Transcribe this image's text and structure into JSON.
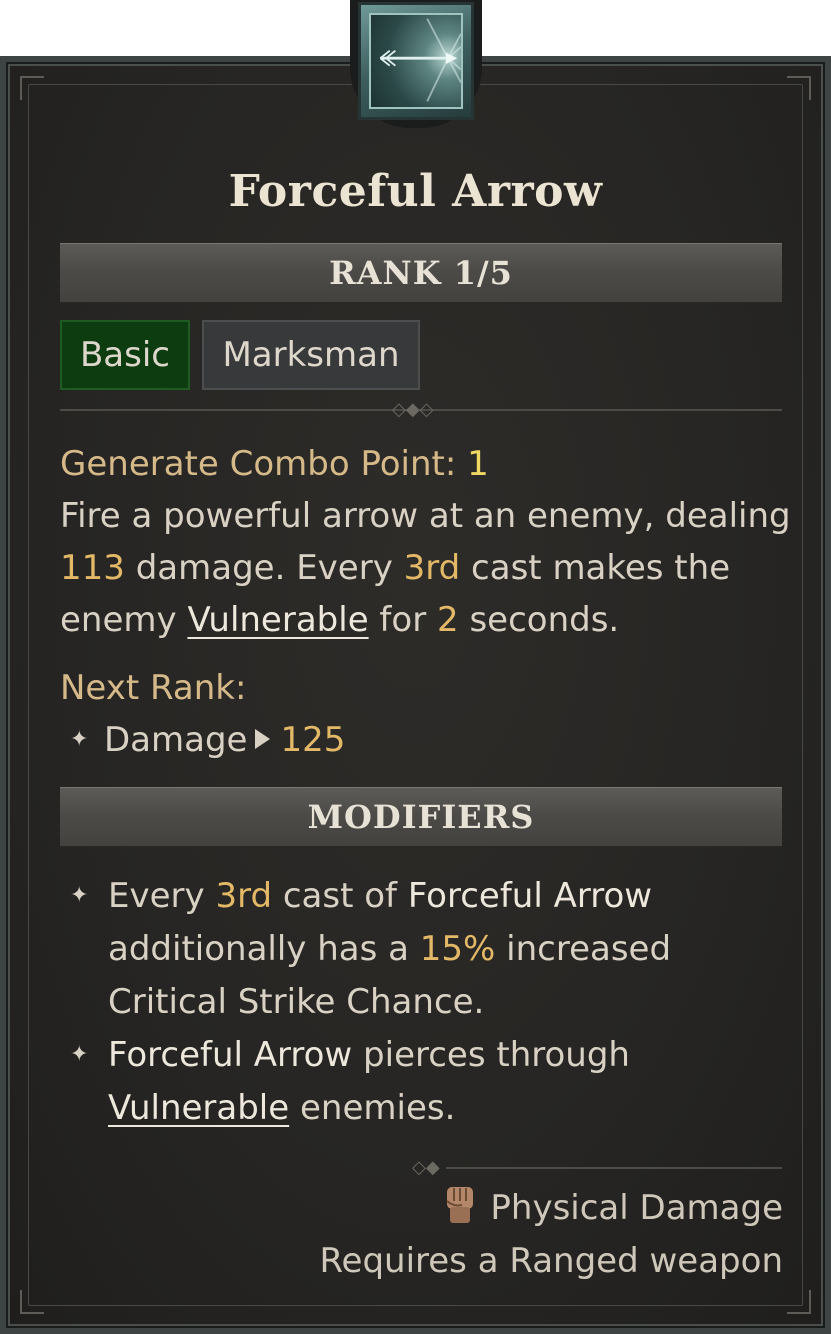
{
  "skill": {
    "name": "Forceful Arrow",
    "rank_label": "RANK 1/5",
    "tags": [
      "Basic",
      "Marksman"
    ],
    "combo_label": "Generate Combo Point: ",
    "combo_value": "1",
    "description": {
      "line1": "Fire a powerful arrow at an enemy, dealing",
      "damage_value": "113",
      "line2a": " damage. Every ",
      "third": "3rd",
      "line2b": " cast makes the",
      "line3a": "enemy ",
      "vulnerable": "Vulnerable",
      "line3b": " for ",
      "seconds_value": "2",
      "line3c": " seconds."
    },
    "next_rank": {
      "label": "Next Rank:",
      "stat_label": "Damage",
      "stat_value": "125"
    },
    "modifiers": {
      "header": "MODIFIERS",
      "mod1": {
        "a": "Every ",
        "third": "3rd",
        "b": " cast of ",
        "skill": "Forceful Arrow",
        "c": "additionally has a ",
        "pct": "15%",
        "d": " increased",
        "e": "Critical Strike Chance."
      },
      "mod2": {
        "skill": "Forceful Arrow",
        "a": " pierces through",
        "vulnerable": "Vulnerable",
        "b": " enemies."
      }
    },
    "damage_type": "Physical Damage",
    "requirement": "Requires a Ranged weapon"
  },
  "colors": {
    "panel_bg": "#262523",
    "gold_value": "#e3b867",
    "combo_value": "#f0d865",
    "basic_tag_bg": "#0d3c10"
  },
  "icons": {
    "skill_icon": "arrow-skill-icon",
    "damage_type_icon": "fist-icon"
  }
}
